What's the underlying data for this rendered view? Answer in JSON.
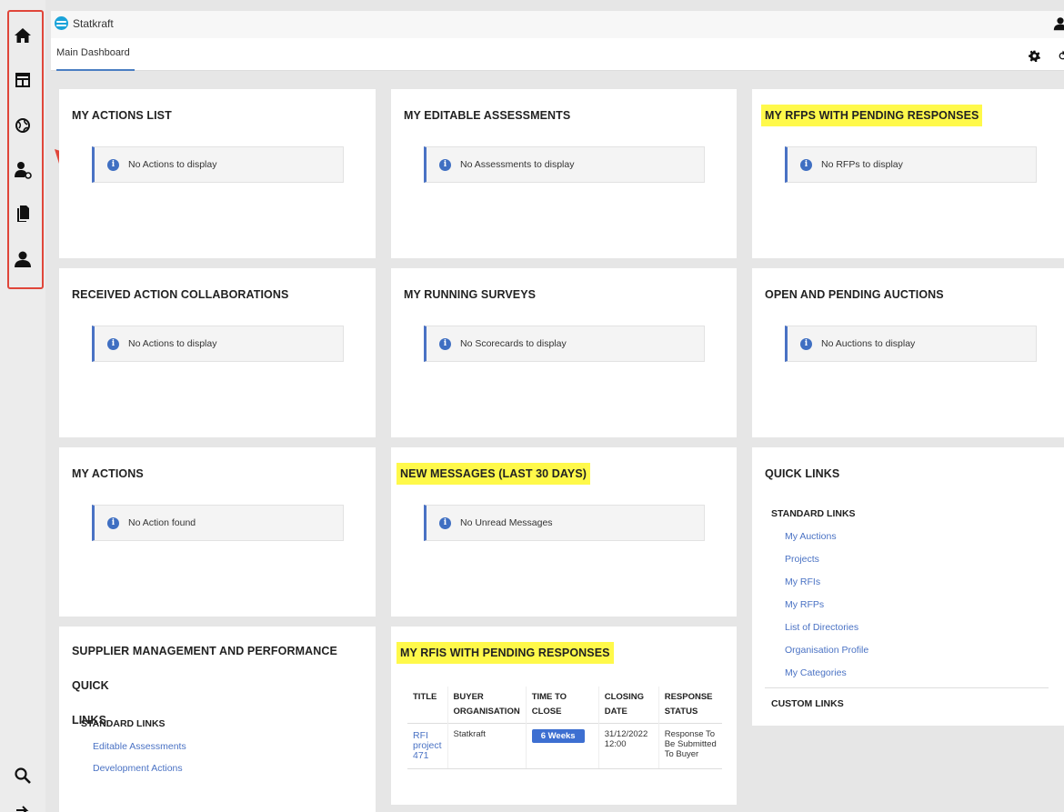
{
  "app": {
    "brand": "Statkraft"
  },
  "tabs": [
    {
      "label": "Main Dashboard"
    }
  ],
  "rail": {
    "items": [
      "home-icon",
      "dashboard-icon",
      "globe-icon",
      "user-settings-icon",
      "documents-icon",
      "user-icon"
    ],
    "bottom": [
      "search-icon",
      "logout-icon"
    ]
  },
  "cards": {
    "actions_list": {
      "title": "MY ACTIONS LIST",
      "notice": "No Actions to display"
    },
    "editable_assessments": {
      "title": "MY EDITABLE ASSESSMENTS",
      "notice": "No Assessments to display"
    },
    "rfps_pending": {
      "title": "MY RFPS WITH PENDING RESPONSES",
      "notice": "No RFPs to display"
    },
    "received_collab": {
      "title": "RECEIVED ACTION COLLABORATIONS",
      "notice": "No Actions to display"
    },
    "running_surveys": {
      "title": "MY RUNNING SURVEYS",
      "notice": "No Scorecards to display"
    },
    "auctions": {
      "title": "OPEN AND PENDING AUCTIONS",
      "notice": "No Auctions to display"
    },
    "my_actions": {
      "title": "MY ACTIONS",
      "notice": "No Action found"
    },
    "new_messages": {
      "title": "NEW MESSAGES (LAST 30 DAYS)",
      "notice": "No Unread Messages"
    },
    "quick_links": {
      "title": "QUICK LINKS",
      "standard_heading": "STANDARD LINKS",
      "links": [
        "My Auctions",
        "Projects",
        "My RFIs",
        "My RFPs",
        "List of Directories",
        "Organisation Profile",
        "My Categories"
      ],
      "custom_heading": "CUSTOM LINKS"
    },
    "supplier_mgmt": {
      "title_line1": "SUPPLIER MANAGEMENT AND PERFORMANCE QUICK",
      "title_line2": "LINKS",
      "standard_heading": "STANDARD LINKS",
      "links": [
        "Editable Assessments",
        "Development Actions"
      ]
    },
    "rfis_pending": {
      "title": "MY RFIS WITH PENDING RESPONSES",
      "columns": [
        "TITLE",
        "BUYER ORGANISATION",
        "TIME TO CLOSE",
        "CLOSING DATE",
        "RESPONSE STATUS"
      ],
      "rows": [
        {
          "title": "RFI project 471",
          "buyer": "Statkraft",
          "time_to_close": "6 Weeks",
          "closing_date": "31/12/2022 12:00",
          "status": "Response To Be Submitted To Buyer"
        }
      ]
    }
  },
  "colors": {
    "accent": "#4a72c4",
    "highlight": "#fff94a",
    "annotation": "#e0463a"
  }
}
